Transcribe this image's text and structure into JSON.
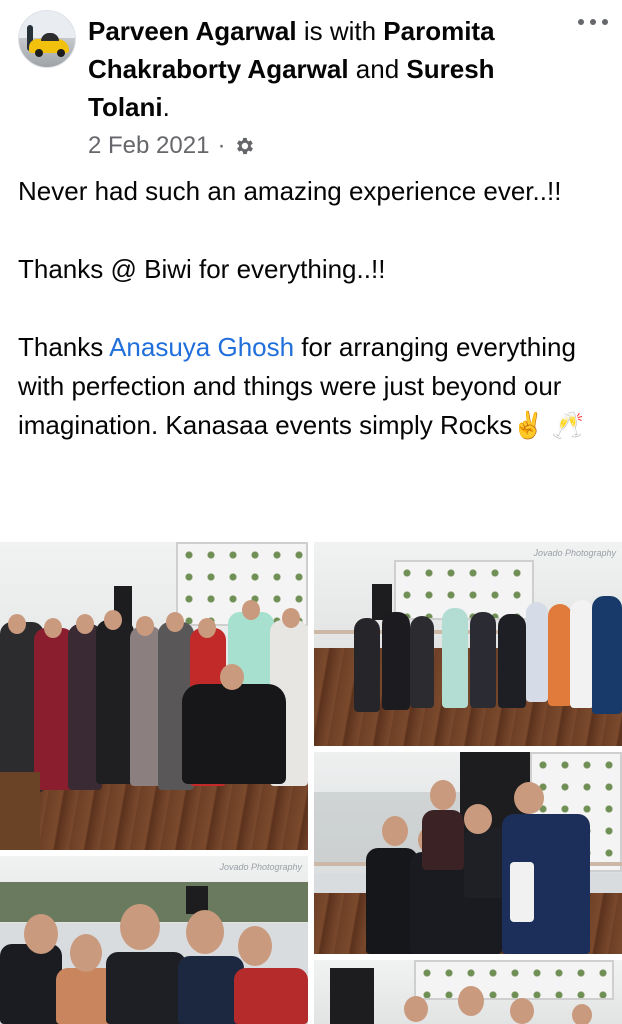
{
  "post": {
    "author": "Parveen Agarwal",
    "with_text": " is with ",
    "tagged_1": "Paromita Chakraborty Agarwal",
    "and_text": " and ",
    "tagged_2": "Suresh Tolani",
    "period": ".",
    "date": "2 Feb 2021",
    "separator": "·",
    "privacy_icon": "gear-icon",
    "more_icon": "more-options-icon"
  },
  "body": {
    "line1": "Never had such an amazing experience ever..!!",
    "line2": "Thanks @ Biwi for everything..!!",
    "line3_prefix": "Thanks ",
    "line3_mention": "Anasuya Ghosh",
    "line3_suffix": " for arranging everything with perfection and things were just beyond our imagination. Kanasaa events simply Rocks",
    "emojis": "✌️ 🥂"
  },
  "photos": [
    {
      "name": "photo-group-deck",
      "watermark": ""
    },
    {
      "name": "photo-group-dancing",
      "watermark": "Jovado Photography"
    },
    {
      "name": "photo-men-lifting",
      "watermark": ""
    },
    {
      "name": "photo-selfie-group",
      "watermark": "Jovado Photography"
    },
    {
      "name": "photo-group-bottom",
      "watermark": ""
    }
  ],
  "colors": {
    "link": "#216fdb",
    "meta": "#65676b",
    "text": "#050505"
  }
}
